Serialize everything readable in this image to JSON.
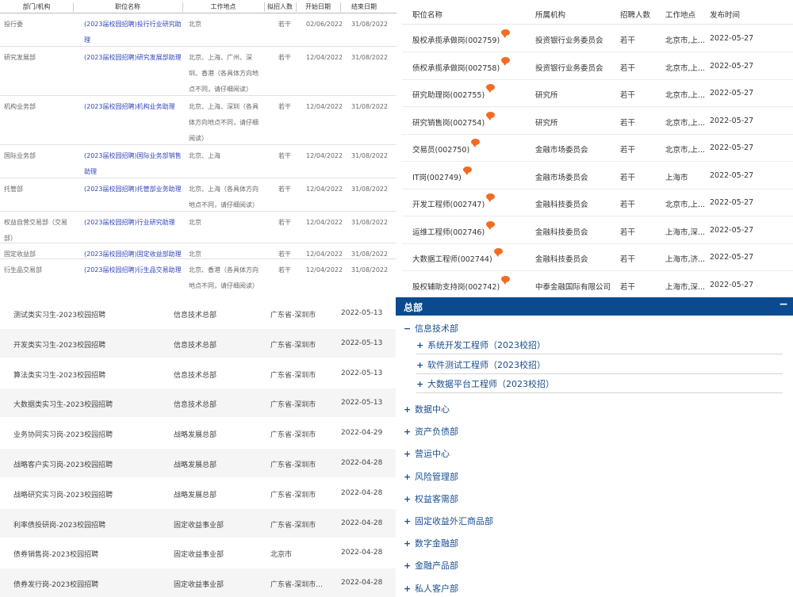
{
  "panel_a": {
    "headers": [
      "部门/机构",
      "职位名称",
      "工作地点",
      "拟招人数",
      "开始日期",
      "结束日期"
    ],
    "rows": [
      {
        "dept": "投行委",
        "title": "(2023届校园招聘)投行行业研究助理",
        "loc": "北京",
        "count": "若干",
        "start": "02/06/2022",
        "end": "31/08/2022"
      },
      {
        "dept": "研究发展部",
        "title": "(2023届校园招聘)研究发展部助理",
        "loc": "北京、上海、广州、深圳、香港（各具体方向地点不同，请仔细阅读）",
        "count": "若干",
        "start": "12/04/2022",
        "end": "31/08/2022"
      },
      {
        "dept": "机构业务部",
        "title": "(2023届校园招聘)机构业务助理",
        "loc": "北京、上海、深圳（各具体方向地点不同，请仔细阅读）",
        "count": "若干",
        "start": "12/04/2022",
        "end": "31/08/2022"
      },
      {
        "dept": "国际业务部",
        "title": "(2023届校园招聘)国际业务部销售助理",
        "loc": "北京、上海",
        "count": "若干",
        "start": "12/04/2022",
        "end": "31/08/2022"
      },
      {
        "dept": "托管部",
        "title": "(2023届校园招聘)托管部业务助理",
        "loc": "北京、上海（各具体方向地点不同，请仔细阅读）",
        "count": "若干",
        "start": "12/04/2022",
        "end": "31/08/2022"
      },
      {
        "dept": "权益自营交易部（交易部）",
        "title": "(2023届校园招聘)行业研究助理",
        "loc": "北京",
        "count": "若干",
        "start": "12/04/2022",
        "end": "31/08/2022"
      },
      {
        "dept": "固定收益部",
        "title": "(2023届校园招聘)固定收益部助理",
        "loc": "北京",
        "count": "若干",
        "start": "12/04/2022",
        "end": "31/08/2022"
      },
      {
        "dept": "衍生品交易部",
        "title": "(2023届校园招聘)衍生品交易助理",
        "loc": "北京、香港（各具体方向地点不同，请仔细阅读）",
        "count": "若干",
        "start": "12/04/2022",
        "end": "31/08/2022"
      }
    ]
  },
  "panel_b": {
    "headers": [
      "职位名称",
      "所属机构",
      "招聘人数",
      "工作地点",
      "发布时间"
    ],
    "rows": [
      {
        "title": "股权承揽承做岗(002759)",
        "org": "投资银行业务委员会",
        "count": "若干",
        "loc": "北京市,上...",
        "date": "2022-05-27"
      },
      {
        "title": "债权承揽承做岗(002758)",
        "org": "投资银行业务委员会",
        "count": "若干",
        "loc": "北京市,上...",
        "date": "2022-05-27"
      },
      {
        "title": "研究助理岗(002755)",
        "org": "研究所",
        "count": "若干",
        "loc": "北京市,上...",
        "date": "2022-05-27"
      },
      {
        "title": "研究销售岗(002754)",
        "org": "研究所",
        "count": "若干",
        "loc": "北京市,上...",
        "date": "2022-05-27"
      },
      {
        "title": "交易员(002750)",
        "org": "金融市场委员会",
        "count": "若干",
        "loc": "北京市,上...",
        "date": "2022-05-27"
      },
      {
        "title": "IT岗(002749)",
        "org": "金融市场委员会",
        "count": "若干",
        "loc": "上海市",
        "date": "2022-05-27"
      },
      {
        "title": "开发工程师(002747)",
        "org": "金融科技委员会",
        "count": "若干",
        "loc": "北京市,上...",
        "date": "2022-05-27"
      },
      {
        "title": "运维工程师(002746)",
        "org": "金融科技委员会",
        "count": "若干",
        "loc": "上海市,深...",
        "date": "2022-05-27"
      },
      {
        "title": "大数据工程师(002744)",
        "org": "金融科技委员会",
        "count": "若干",
        "loc": "上海市,济...",
        "date": "2022-05-27"
      },
      {
        "title": "股权辅助支持岗(002742)",
        "org": "中泰金融国际有限公司",
        "count": "若干",
        "loc": "上海市,深...",
        "date": "2022-05-27"
      }
    ]
  },
  "panel_c": {
    "rows": [
      {
        "title": "测试类实习生-2023校园招聘",
        "dept": "信息技术总部",
        "loc": "广东省-深圳市",
        "date": "2022-05-13"
      },
      {
        "title": "开发类实习生-2023校园招聘",
        "dept": "信息技术总部",
        "loc": "广东省-深圳市",
        "date": "2022-05-13"
      },
      {
        "title": "算法类实习生-2023校园招聘",
        "dept": "信息技术总部",
        "loc": "广东省-深圳市",
        "date": "2022-05-13"
      },
      {
        "title": "大数据类实习生-2023校园招聘",
        "dept": "信息技术总部",
        "loc": "广东省-深圳市",
        "date": "2022-05-13"
      },
      {
        "title": "业务协同实习岗-2023校园招聘",
        "dept": "战略发展总部",
        "loc": "广东省-深圳市",
        "date": "2022-04-29"
      },
      {
        "title": "战略客户实习岗-2023校园招聘",
        "dept": "战略发展总部",
        "loc": "广东省-深圳市",
        "date": "2022-04-28"
      },
      {
        "title": "战略研究实习岗-2023校园招聘",
        "dept": "战略发展总部",
        "loc": "广东省-深圳市",
        "date": "2022-04-28"
      },
      {
        "title": "利率债投研岗-2023校园招聘",
        "dept": "固定收益事业部",
        "loc": "广东省-深圳市",
        "date": "2022-04-28"
      },
      {
        "title": "债券销售岗-2023校园招聘",
        "dept": "固定收益事业部",
        "loc": "北京市",
        "date": "2022-04-28"
      },
      {
        "title": "债券发行岗-2023校园招聘",
        "dept": "固定收益事业部",
        "loc": "广东省-深圳市...",
        "date": "2022-04-28"
      }
    ]
  },
  "panel_d": {
    "title": "总部",
    "collapse_symbol": "−",
    "expanded": {
      "label": "信息技术部",
      "symbol": "−",
      "children": [
        "系统开发工程师（2023校招）",
        "软件测试工程师（2023校招）",
        "大数据平台工程师（2023校招）"
      ]
    },
    "child_symbol": "+",
    "items": [
      "数据中心",
      "资产负债部",
      "营运中心",
      "风险管理部",
      "权益客需部",
      "固定收益外汇商品部",
      "数字金融部",
      "金融产品部",
      "私人客户部"
    ],
    "item_symbol": "+"
  },
  "colors": {
    "link": "#3344bb",
    "tree_text": "#1a4f8f",
    "tree_bar": "#0b4a8f",
    "bubble": "#f26b21"
  }
}
